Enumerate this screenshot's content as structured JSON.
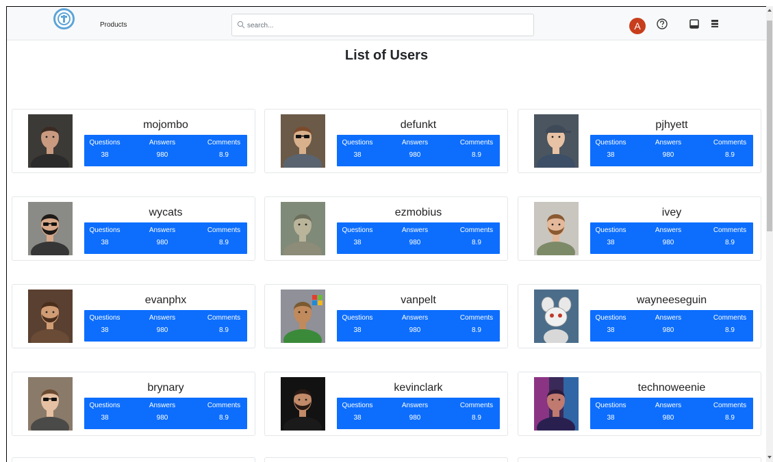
{
  "nav": {
    "products_label": "Products",
    "search_placeholder": "search...",
    "avatar_initial": "A"
  },
  "page": {
    "title": "List of Users"
  },
  "stat_labels": {
    "questions": "Questions",
    "answers": "Answers",
    "comments": "Comments"
  },
  "users": [
    {
      "name": "mojombo",
      "questions": "38",
      "answers": "980",
      "comments": "8.9"
    },
    {
      "name": "defunkt",
      "questions": "38",
      "answers": "980",
      "comments": "8.9"
    },
    {
      "name": "pjhyett",
      "questions": "38",
      "answers": "980",
      "comments": "8.9"
    },
    {
      "name": "wycats",
      "questions": "38",
      "answers": "980",
      "comments": "8.9"
    },
    {
      "name": "ezmobius",
      "questions": "38",
      "answers": "980",
      "comments": "8.9"
    },
    {
      "name": "ivey",
      "questions": "38",
      "answers": "980",
      "comments": "8.9"
    },
    {
      "name": "evanphx",
      "questions": "38",
      "answers": "980",
      "comments": "8.9"
    },
    {
      "name": "vanpelt",
      "questions": "38",
      "answers": "980",
      "comments": "8.9"
    },
    {
      "name": "wayneeseguin",
      "questions": "38",
      "answers": "980",
      "comments": "8.9"
    },
    {
      "name": "brynary",
      "questions": "38",
      "answers": "980",
      "comments": "8.9"
    },
    {
      "name": "kevinclark",
      "questions": "38",
      "answers": "980",
      "comments": "8.9"
    },
    {
      "name": "technoweenie",
      "questions": "38",
      "answers": "980",
      "comments": "8.9"
    }
  ],
  "colors": {
    "accent": "#0d6efd",
    "avatar": "#c83e1c",
    "logo": "#5da4d8"
  },
  "icons": {
    "logo": "logo-icon",
    "search": "search-icon",
    "help": "help-icon",
    "inbox": "inbox-icon",
    "menu": "menu-icon"
  }
}
